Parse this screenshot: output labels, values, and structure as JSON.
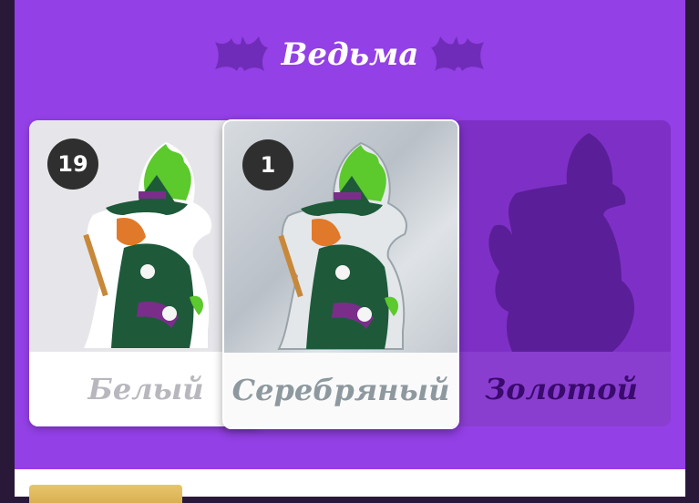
{
  "header": {
    "title": "Ведьма"
  },
  "cards": [
    {
      "label": "Белый",
      "count": "19",
      "state": "owned"
    },
    {
      "label": "Серебряный",
      "count": "1",
      "state": "owned"
    },
    {
      "label": "Золотой",
      "count": null,
      "state": "locked"
    }
  ],
  "colors": {
    "panel": "#9340e6",
    "locked_bg": "#7e30c6",
    "locked_label": "#3a0a6e"
  },
  "icons": [
    "bat-icon",
    "witch-deer-sticker",
    "locked-silhouette"
  ]
}
